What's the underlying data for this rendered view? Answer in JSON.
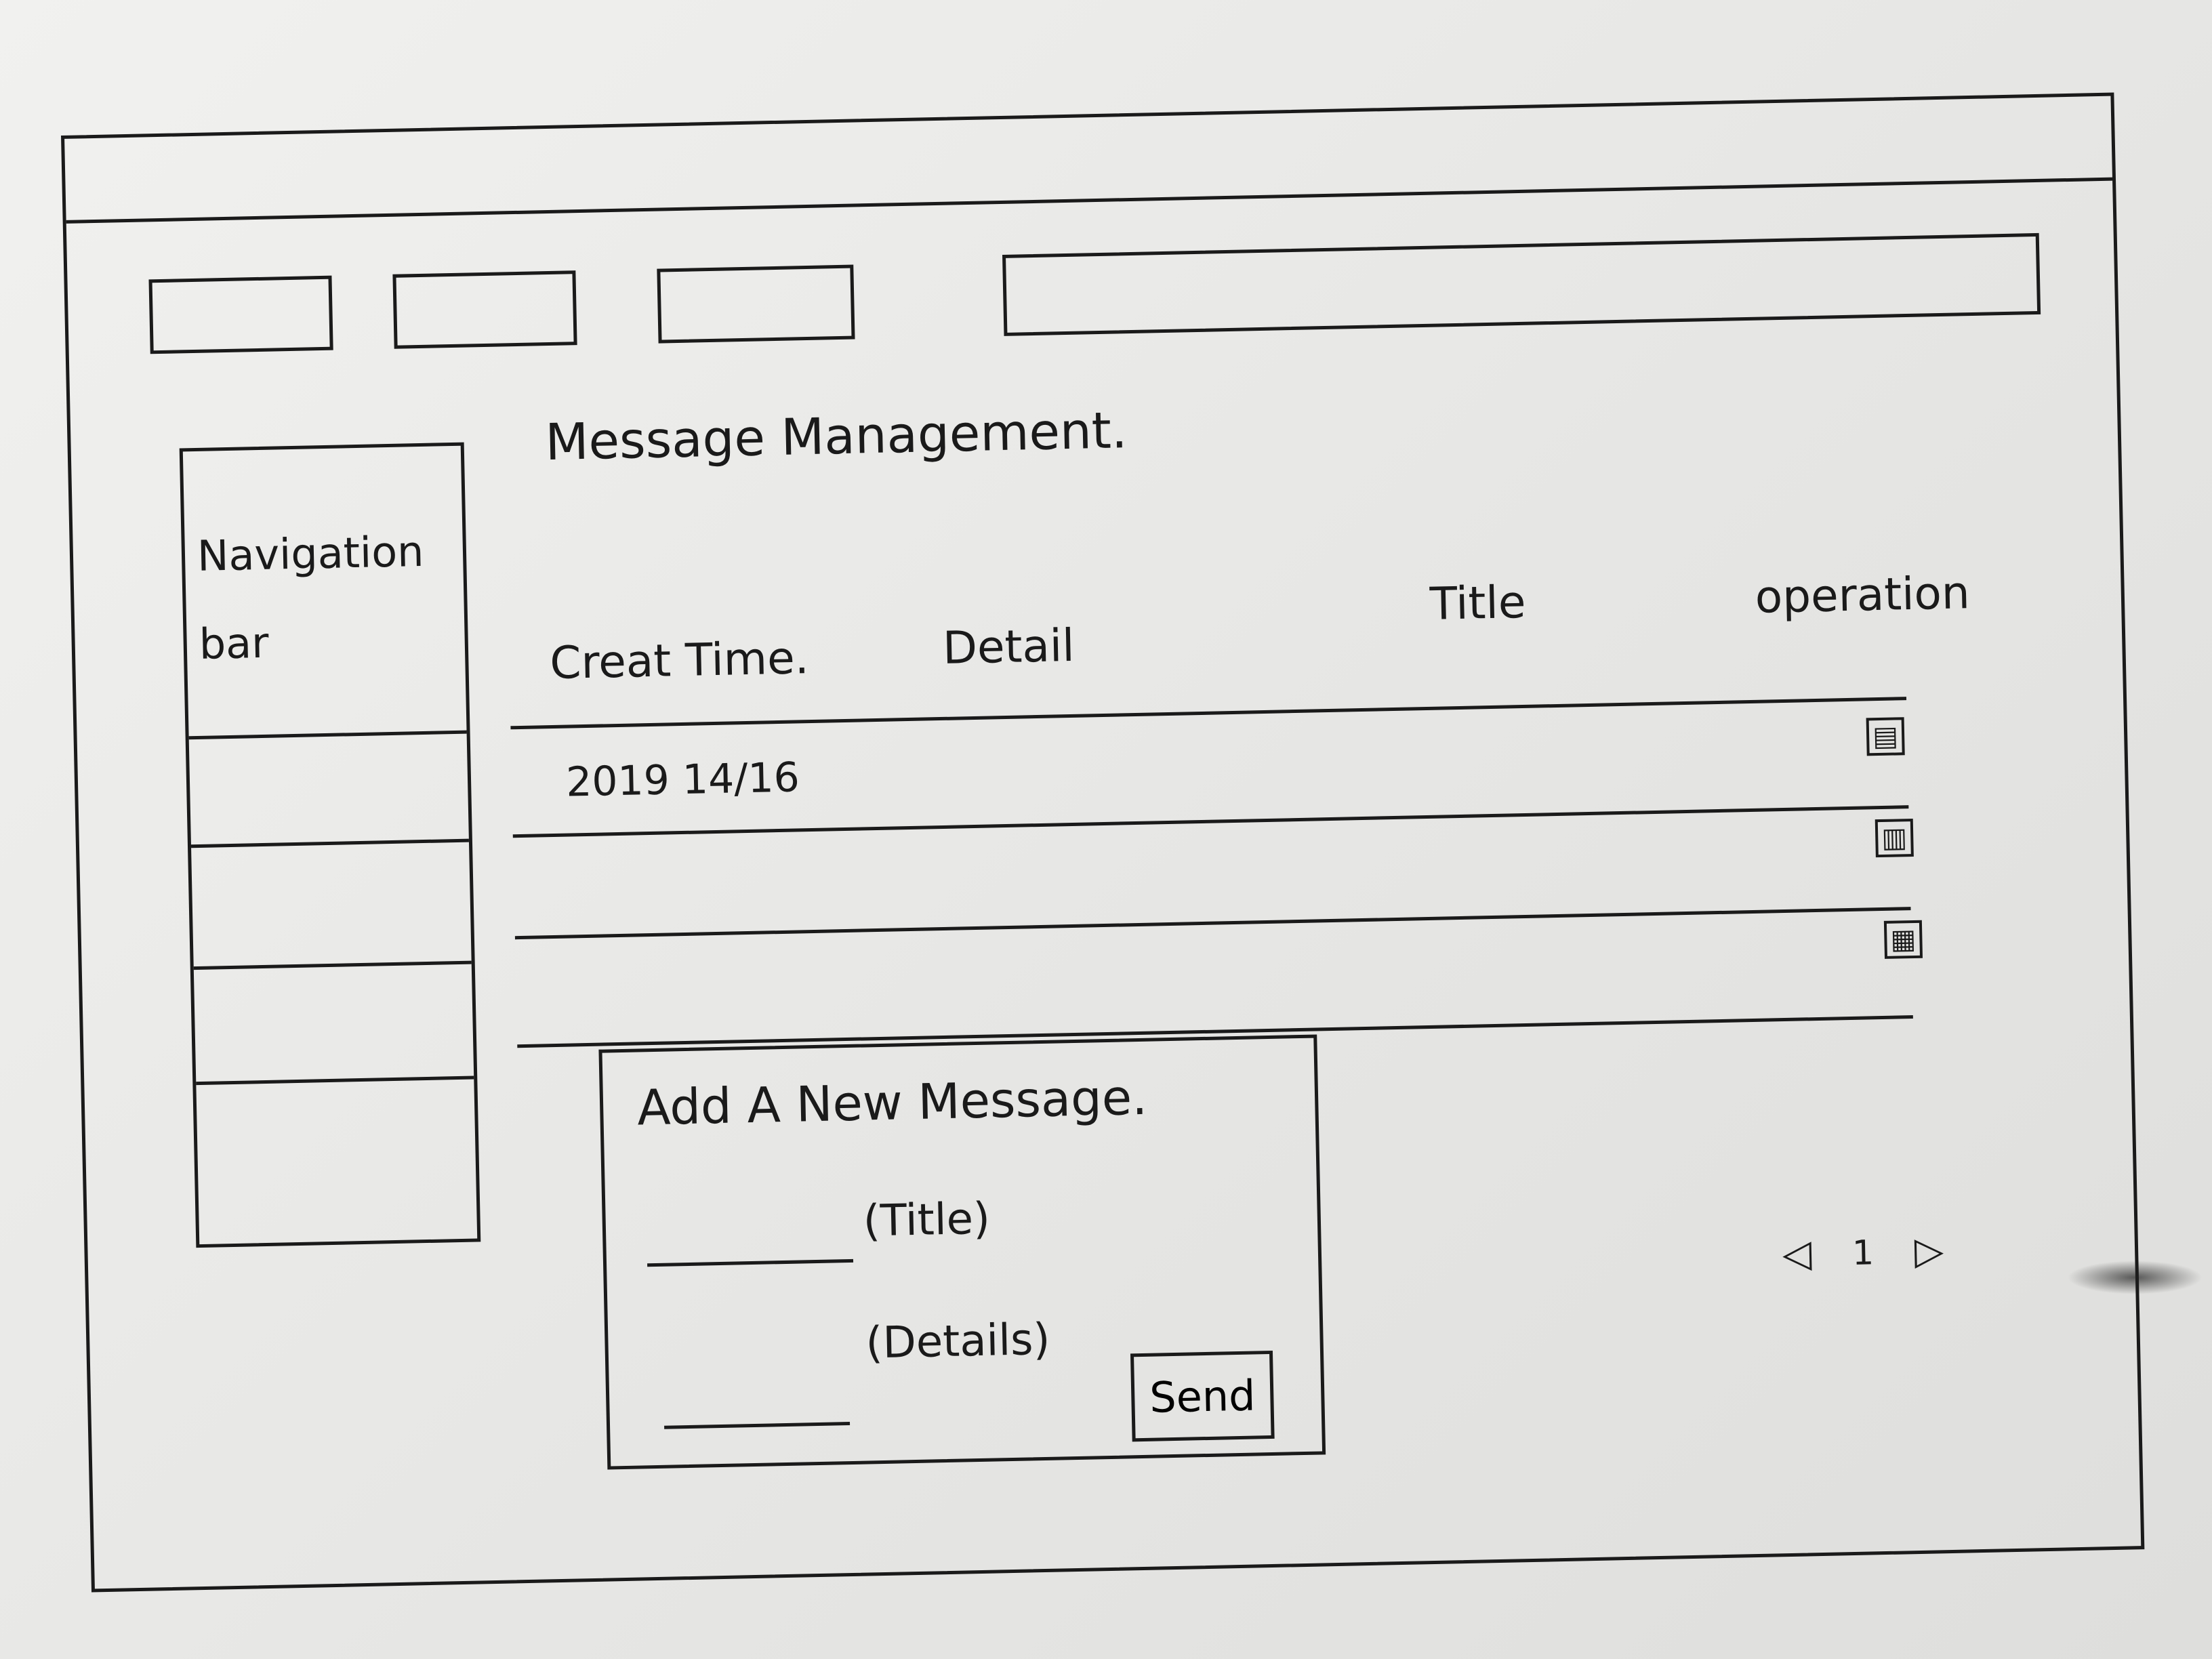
{
  "header": {
    "top_buttons": [
      "",
      "",
      ""
    ],
    "search": {
      "value": "",
      "placeholder": ""
    }
  },
  "sidebar": {
    "title": "Navigation bar",
    "items": [
      "",
      "",
      ""
    ]
  },
  "main": {
    "title": "Message Management.",
    "table": {
      "columns": [
        "Creat Time.",
        "Detail",
        "Title",
        "operation"
      ],
      "rows": [
        {
          "create_time": "2019 14/16",
          "detail": "",
          "title": ""
        },
        {
          "create_time": "",
          "detail": "",
          "title": ""
        },
        {
          "create_time": "",
          "detail": "",
          "title": ""
        }
      ],
      "row_icons": [
        "file-icon",
        "delete-icon",
        "edit-icon"
      ]
    }
  },
  "new_message": {
    "heading": "Add A New Message.",
    "title_label": "(Title)",
    "details_label": "(Details)",
    "title_value": "",
    "details_value": "",
    "send_label": "Send"
  },
  "pagination": {
    "prev_icon": "triangle-left-icon",
    "current_page": "1",
    "next_icon": "triangle-right-icon"
  }
}
